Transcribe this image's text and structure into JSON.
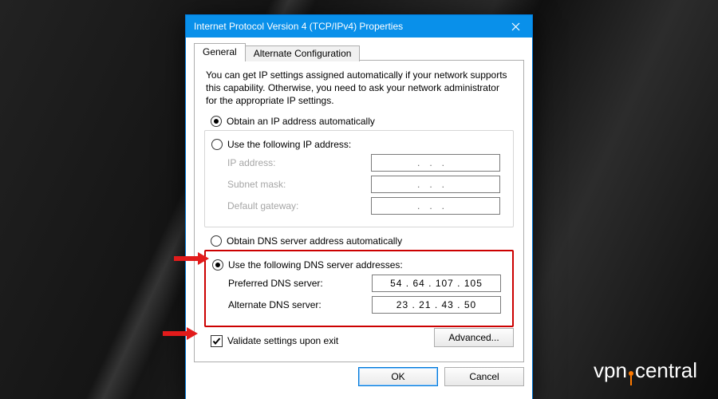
{
  "window": {
    "title": "Internet Protocol Version 4 (TCP/IPv4) Properties"
  },
  "tabs": {
    "general": "General",
    "alt": "Alternate Configuration"
  },
  "description": "You can get IP settings assigned automatically if your network supports this capability. Otherwise, you need to ask your network administrator for the appropriate IP settings.",
  "ip_section": {
    "auto_label": "Obtain an IP address automatically",
    "manual_label": "Use the following IP address:",
    "mode": "auto",
    "fields": {
      "ip_label": "IP address:",
      "mask_label": "Subnet mask:",
      "gw_label": "Default gateway:",
      "ip_value": "",
      "mask_value": "",
      "gw_value": ""
    }
  },
  "dns_section": {
    "auto_label": "Obtain DNS server address automatically",
    "manual_label": "Use the following DNS server addresses:",
    "mode": "manual",
    "pref_label": "Preferred DNS server:",
    "alt_label": "Alternate DNS server:",
    "pref_value": "54  .  64  . 107 . 105",
    "alt_value": "23  .  21  .  43  .  50"
  },
  "validate": {
    "label": "Validate settings upon exit",
    "checked": true
  },
  "buttons": {
    "advanced": "Advanced...",
    "ok": "OK",
    "cancel": "Cancel"
  },
  "watermark": {
    "left": "vpn",
    "right": "central"
  }
}
